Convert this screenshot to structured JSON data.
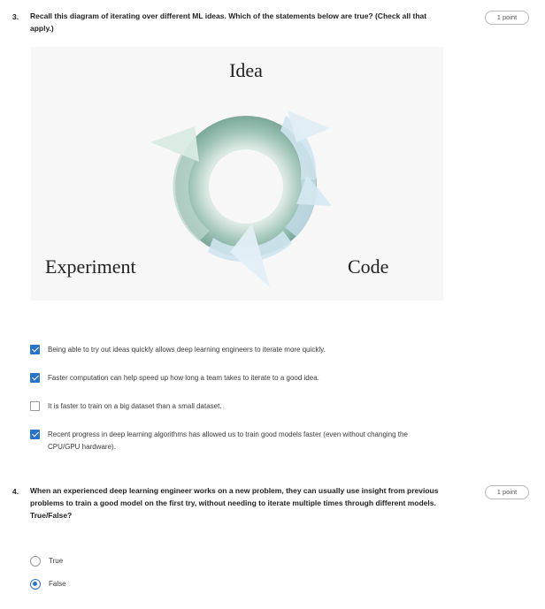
{
  "questions": [
    {
      "number": "3.",
      "text": "Recall this diagram of iterating over different ML ideas. Which of the statements below are true? (Check all that apply.)",
      "points": "1 point",
      "diagram": {
        "top_label": "Idea",
        "left_label": "Experiment",
        "right_label": "Code"
      },
      "options": [
        {
          "label": "Being able to try out ideas quickly allows deep learning engineers to iterate more quickly.",
          "checked": true
        },
        {
          "label": "Faster computation can help speed up how long a team takes to iterate to a good idea.",
          "checked": true
        },
        {
          "label": "It is faster to train on a big dataset than a small dataset.",
          "checked": false
        },
        {
          "label": "Recent progress in deep learning algorithms has allowed us to train good models faster (even without changing the CPU/GPU hardware).",
          "checked": true
        }
      ]
    },
    {
      "number": "4.",
      "text": "When an experienced deep learning engineer works on a new problem, they can usually use insight from previous problems to train a good model on the first try, without needing to iterate multiple times through different models. True/False?",
      "points": "1 point",
      "options": [
        {
          "label": "True",
          "selected": false
        },
        {
          "label": "False",
          "selected": true
        }
      ]
    }
  ],
  "colors": {
    "accent": "#2a73cc",
    "ring": "#8fb8ac",
    "arrow": "#cfe4ee"
  }
}
